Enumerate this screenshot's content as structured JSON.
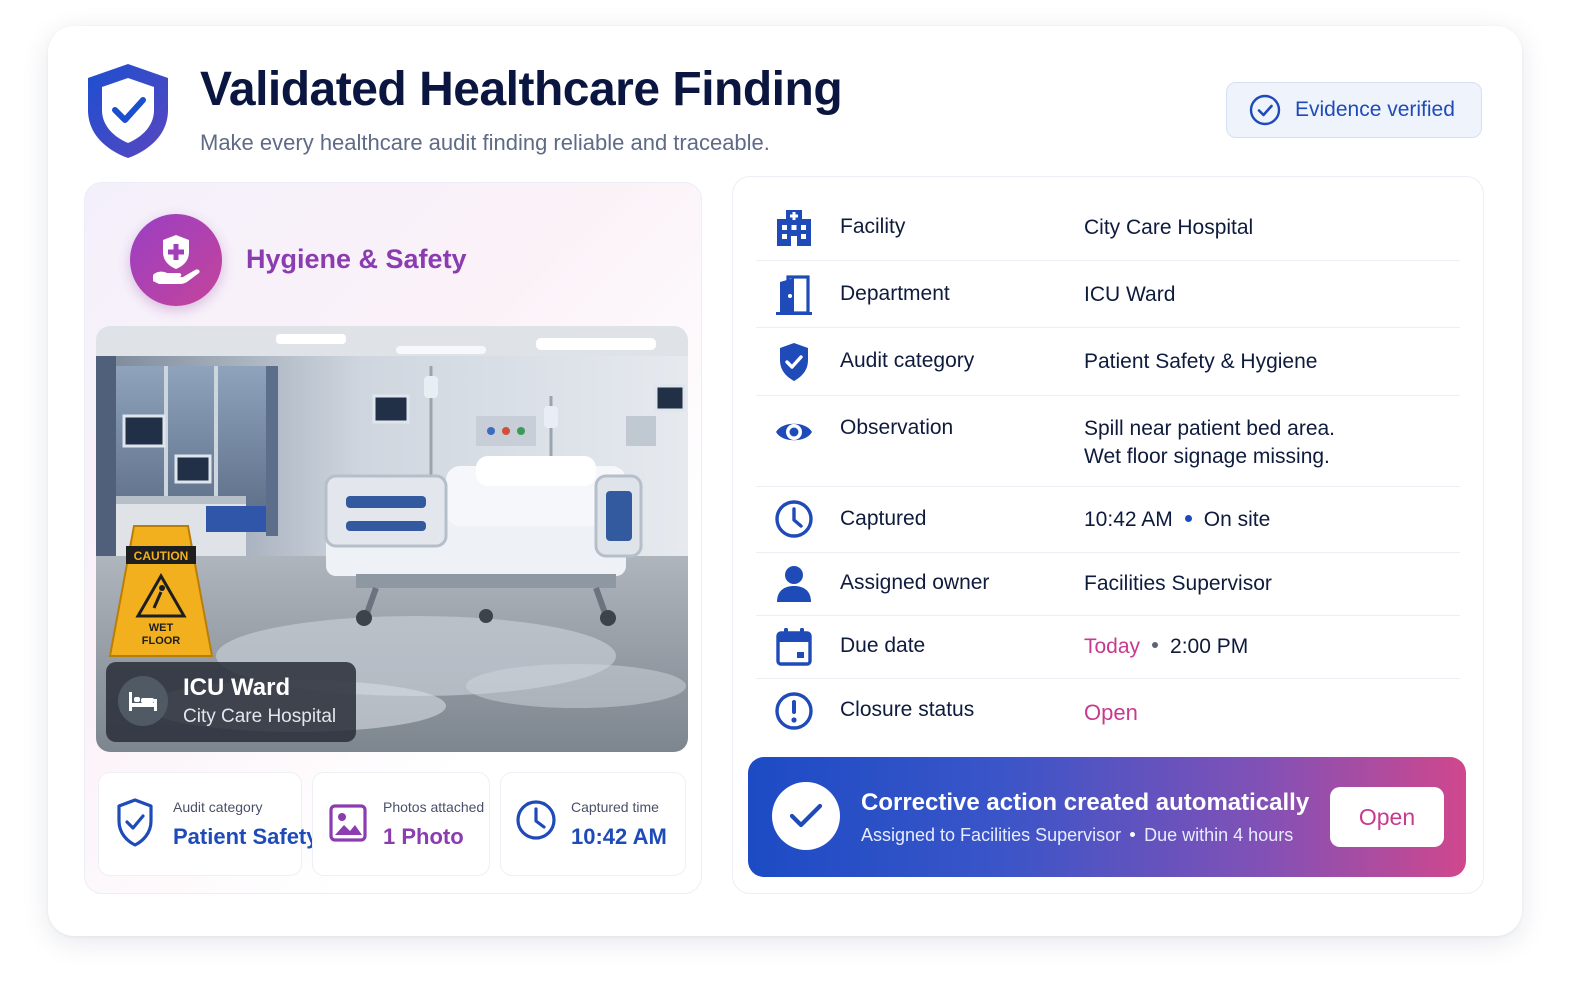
{
  "header": {
    "title": "Validated Healthcare Finding",
    "subtitle": "Make every healthcare audit finding reliable and traceable.",
    "verified_badge": "Evidence verified"
  },
  "category": {
    "label": "Hygiene & Safety",
    "icon": "shield-hand-icon"
  },
  "photo": {
    "caution_sign_text": [
      "CAUTION",
      "WET",
      "FLOOR"
    ],
    "location_title": "ICU Ward",
    "location_subtitle": "City Care Hospital"
  },
  "stats": [
    {
      "label": "Audit category",
      "value": "Patient Safety",
      "icon": "shield-check-icon"
    },
    {
      "label": "Photos attached",
      "value": "1 Photo",
      "icon": "image-icon"
    },
    {
      "label": "Captured time",
      "value": "10:42 AM",
      "icon": "clock-icon"
    }
  ],
  "details": {
    "facility": {
      "label": "Facility",
      "value": "City Care Hospital",
      "icon": "hospital-icon"
    },
    "department": {
      "label": "Department",
      "value": "ICU Ward",
      "icon": "door-icon"
    },
    "audit_category": {
      "label": "Audit category",
      "value": "Patient Safety & Hygiene",
      "icon": "shield-check-icon"
    },
    "observation": {
      "label": "Observation",
      "value_line1": "Spill near patient bed area.",
      "value_line2": "Wet floor signage missing.",
      "icon": "eye-icon"
    },
    "captured": {
      "label": "Captured",
      "time": "10:42 AM",
      "place": "On site",
      "icon": "clock-icon"
    },
    "assigned_owner": {
      "label": "Assigned owner",
      "value": "Facilities Supervisor",
      "icon": "user-icon"
    },
    "due_date": {
      "label": "Due date",
      "day": "Today",
      "time": "2:00 PM",
      "icon": "calendar-icon"
    },
    "closure_status": {
      "label": "Closure status",
      "value": "Open",
      "icon": "alert-icon"
    }
  },
  "action": {
    "title": "Corrective action created automatically",
    "assigned": "Assigned to Facilities Supervisor",
    "due": "Due within 4 hours",
    "button": "Open"
  },
  "colors": {
    "primary_blue": "#1f4bb8",
    "accent_pink": "#c83a8e",
    "accent_purple": "#8a3cb0",
    "title_navy": "#0b1640"
  }
}
